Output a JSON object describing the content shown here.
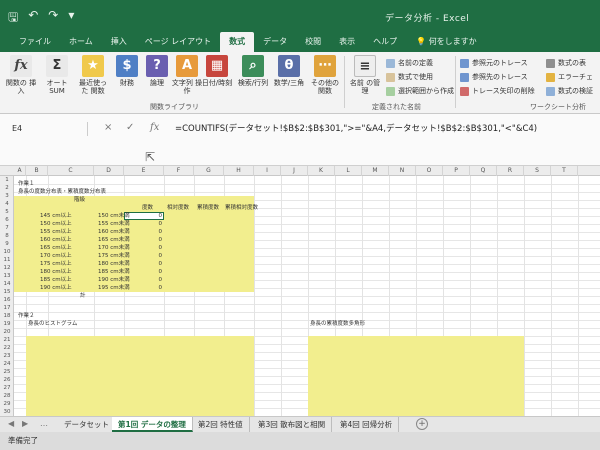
{
  "titlebar": {
    "title": "データ分析 - Excel"
  },
  "tabs": [
    "ファイル",
    "ホーム",
    "挿入",
    "ページ レイアウト",
    "数式",
    "データ",
    "校閲",
    "表示",
    "ヘルプ"
  ],
  "tell_me": "何をしますか",
  "ribbon": {
    "insert_function": "関数の 挿入",
    "autosum": "オート SUM",
    "recent": "最近使った 関数",
    "financial": "財務",
    "logical": "論理",
    "text": "文字列 操作",
    "datetime": "日付/時刻",
    "lookup": "検索/行列",
    "math": "数学/三角",
    "more": "その他の 関数",
    "group_library": "関数ライブラリ",
    "name_manager": "名前 の管理",
    "define_name": "名前の定義",
    "use_in_formula": "数式で使用",
    "create_from_selection": "選択範囲から作成",
    "group_names": "定義された名前",
    "trace_precedents": "参照元のトレース",
    "trace_dependents": "参照先のトレース",
    "remove_arrows": "トレース矢印の削除",
    "show_formulas": "数式の表",
    "error_checking": "エラーチェ",
    "evaluate_formula": "数式の検証",
    "group_audit": "ワークシート分析"
  },
  "formula_bar": {
    "name_box": "E4",
    "cancel_icon": "×",
    "enter_icon": "✓",
    "fx": "fx",
    "formula": "=COUNTIFS(データセット!$B$2:$B$301,\">=\"&A4,データセット!$B$2:$B$301,\"<\"&C4)"
  },
  "columns": [
    "A",
    "B",
    "C",
    "D",
    "E",
    "F",
    "G",
    "H",
    "I",
    "J",
    "K",
    "L",
    "M",
    "N",
    "O",
    "P",
    "Q",
    "R",
    "S",
    "T"
  ],
  "sheet": {
    "task1": "作業１",
    "table_title": "身長の度数分布表・累積度数分布表",
    "col_class": "階級",
    "col_freq": "度数",
    "col_relfreq": "相対度数",
    "col_cumfreq": "累積度数",
    "col_cumrel": "累積相対度数",
    "rows": [
      {
        "from": "145 cm以上",
        "to": "150 cm未満",
        "freq": "0"
      },
      {
        "from": "150 cm以上",
        "to": "155 cm未満",
        "freq": "0"
      },
      {
        "from": "155 cm以上",
        "to": "160 cm未満",
        "freq": "0"
      },
      {
        "from": "160 cm以上",
        "to": "165 cm未満",
        "freq": "0"
      },
      {
        "from": "165 cm以上",
        "to": "170 cm未満",
        "freq": "0"
      },
      {
        "from": "170 cm以上",
        "to": "175 cm未満",
        "freq": "0"
      },
      {
        "from": "175 cm以上",
        "to": "180 cm未満",
        "freq": "0"
      },
      {
        "from": "180 cm以上",
        "to": "185 cm未満",
        "freq": "0"
      },
      {
        "from": "185 cm以上",
        "to": "190 cm未満",
        "freq": "0"
      },
      {
        "from": "190 cm以上",
        "to": "195 cm未満",
        "freq": "0"
      }
    ],
    "total": "計",
    "task2": "作業２",
    "histogram_title": "身長のヒストグラム",
    "polygon_title": "身長の累積度数多角形"
  },
  "sheet_tabs": [
    "データセット",
    "第1回 データの整理",
    "第2回 特性値",
    "第3回 散布図と相関",
    "第4回 回帰分析"
  ],
  "status": "準備完了"
}
